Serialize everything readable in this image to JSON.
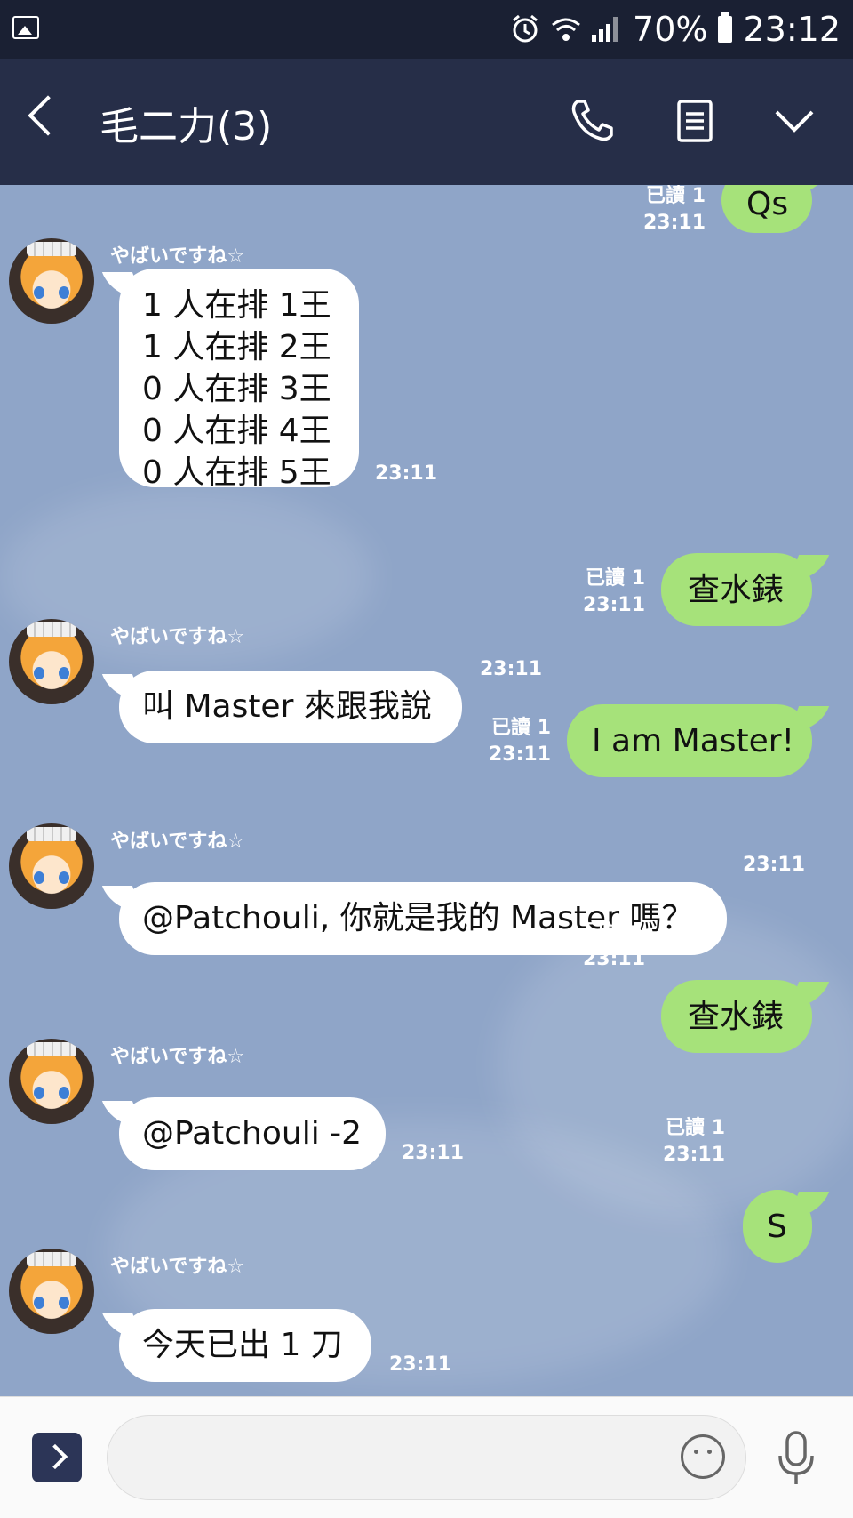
{
  "status_bar": {
    "battery": "70%",
    "time": "23:12"
  },
  "header": {
    "title": "毛二力(3)"
  },
  "messages": [
    {
      "dir": "out",
      "text": "Qs",
      "read": "已讀 1",
      "time": "23:11"
    },
    {
      "dir": "in",
      "sender": "やばいですね☆",
      "lines": [
        "1 人在排 1王",
        "1 人在排 2王",
        "0 人在排 3王",
        "0 人在排 4王",
        "0 人在排 5王"
      ],
      "time": "23:11"
    },
    {
      "dir": "out",
      "text": "查水錶",
      "read": "已讀 1",
      "time": "23:11"
    },
    {
      "dir": "in",
      "sender": "やばいですね☆",
      "text": "叫 Master 來跟我說",
      "time": "23:11"
    },
    {
      "dir": "out",
      "text": "I am Master!",
      "read": "已讀 1",
      "time": "23:11"
    },
    {
      "dir": "in",
      "sender": "やばいですね☆",
      "text": "@Patchouli, 你就是我的 Master 嗎？",
      "time": "23:11"
    },
    {
      "dir": "out",
      "text": "查水錶",
      "read": "已讀 1",
      "time": "23:11"
    },
    {
      "dir": "in",
      "sender": "やばいですね☆",
      "text": "@Patchouli -2",
      "time": "23:11"
    },
    {
      "dir": "out",
      "text": "S",
      "read": "已讀 1",
      "time": "23:11"
    },
    {
      "dir": "in",
      "sender": "やばいですね☆",
      "text": "今天已出 1 刀",
      "time": "23:11"
    }
  ],
  "input": {
    "placeholder": ""
  },
  "icons": [
    "image-icon",
    "battery-icon",
    "alarm-icon",
    "wifi-icon",
    "signal-icon",
    "back-icon",
    "phone-icon",
    "notes-icon",
    "chevron-down-icon",
    "expand-icon",
    "emoji-icon",
    "mic-icon"
  ],
  "colors": {
    "status_bar": "#1a2033",
    "header": "#262e48",
    "chat_bg": "#8fa5c8",
    "outgoing_bubble": "#a6e27a",
    "incoming_bubble": "#ffffff"
  }
}
